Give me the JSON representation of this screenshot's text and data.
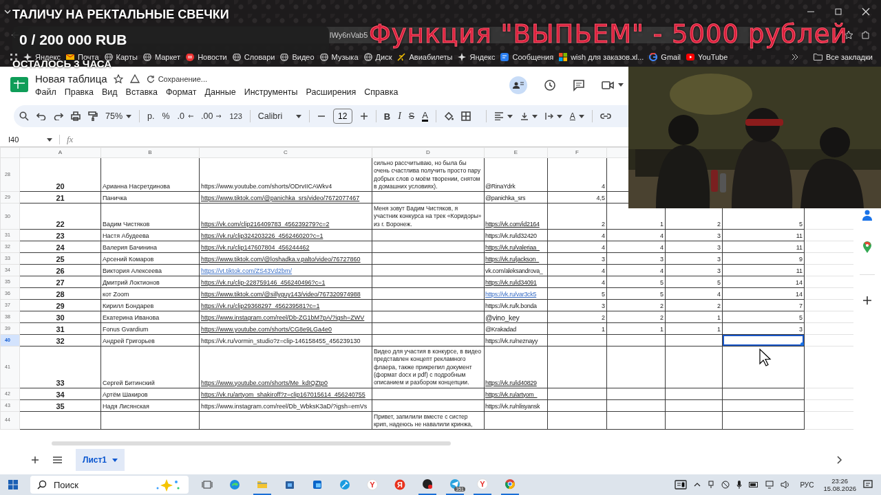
{
  "stream_overlay": {
    "title": "ТАЛИЧУ НА РЕКТАЛЬНЫЕ СВЕЧКИ",
    "goal": "0 / 200 000 RUB",
    "time_left": "ОСТАЛОСЬ 3 ЧАСА",
    "promo": "Функция \"ВЫПЬЕМ\" - 5000 рублей"
  },
  "browser": {
    "address": "lWy6nVab5",
    "bookmarks": [
      {
        "label": "Яндекс",
        "kind": "sparkle"
      },
      {
        "label": "Почта",
        "kind": "mail"
      },
      {
        "label": "Карты",
        "kind": "globe"
      },
      {
        "label": "Маркет",
        "kind": "globe"
      },
      {
        "label": "Новости",
        "kind": "news"
      },
      {
        "label": "Словари",
        "kind": "globe"
      },
      {
        "label": "Видео",
        "kind": "globe"
      },
      {
        "label": "Музыка",
        "kind": "globe"
      },
      {
        "label": "Диск",
        "kind": "globe"
      },
      {
        "label": "Авиабилеты",
        "kind": "plane"
      },
      {
        "label": "Яндекс",
        "kind": "sparkle"
      },
      {
        "label": "Сообщения",
        "kind": "chat"
      },
      {
        "label": "wish для заказов.xl...",
        "kind": "tiles"
      },
      {
        "label": "Gmail",
        "kind": "google"
      },
      {
        "label": "YouTube",
        "kind": "play"
      }
    ],
    "all_bookmarks": "Все закладки"
  },
  "sheets": {
    "doc_title": "Новая таблица",
    "save_status": "Сохранение...",
    "menu": [
      "Файл",
      "Правка",
      "Вид",
      "Вставка",
      "Формат",
      "Данные",
      "Инструменты",
      "Расширения",
      "Справка"
    ],
    "toolbar": {
      "zoom": "75%",
      "currency": "р.",
      "percent": "%",
      "decimal_less": ".0",
      "decimal_more": ".00",
      "number_format": "123",
      "font": "Calibri",
      "font_size": "12",
      "bold": "B",
      "italic": "I",
      "strikethrough": "S",
      "text_color": "A",
      "text_rotation": "A"
    },
    "name_box": "I40",
    "formula_label": "fx",
    "columns": [
      "A",
      "B",
      "C",
      "D",
      "E",
      "F"
    ],
    "rows": [
      {
        "header": "28",
        "selected": false,
        "number": "20",
        "name": "Арианна Насретдинова",
        "video": {
          "text": "https://www.youtube.com/shorts/ODrvIICAWkv4",
          "kind": "plain"
        },
        "note": "сильно рассчитываю, но была бы очень счастлива получить просто пару добрых слов о моём творении, снятом в домашних условиях).",
        "profile": {
          "text": "@RinaYdrk",
          "kind": "plain"
        },
        "scores": [
          "4"
        ]
      },
      {
        "header": "29",
        "selected": false,
        "number": "21",
        "name": "Паничка",
        "video": {
          "text": "https://www.tiktok.com/@panichka_srs/video/7672077467",
          "kind": "underlined"
        },
        "profile": {
          "text": "@panichka_srs",
          "kind": "plain"
        },
        "scores": [
          "4,5"
        ]
      },
      {
        "header": "30",
        "selected": false,
        "number": "22",
        "name": "Вадим Чистяков",
        "video": {
          "text": "https://vk.com/clip216409783_456239279?c=2",
          "kind": "underlined"
        },
        "note": "Меня зовут Вадим Чистяков, я участник конкурса на трек «Коридоры» из г. Воронеж.",
        "profile": {
          "text": "https://vk.com/id2164",
          "kind": "underlined"
        },
        "scores": [
          "2",
          "1",
          "2",
          "5"
        ]
      },
      {
        "header": "31",
        "selected": false,
        "number": "23",
        "name": "Настя Абудеева",
        "video": {
          "text": "https://vk.ru/clip324203226_456246020?c=1",
          "kind": "underlined"
        },
        "profile": {
          "text": "https://vk.ru/id32420",
          "kind": "plain"
        },
        "scores": [
          "4",
          "4",
          "3",
          "11"
        ]
      },
      {
        "header": "32",
        "selected": false,
        "number": "24",
        "name": "Валерия Бачинина",
        "video": {
          "text": "https://vk.ru/clip147607804_456244462",
          "kind": "underlined"
        },
        "profile": {
          "text": "https://vk.ru/valeriaa_",
          "kind": "underlined"
        },
        "scores": [
          "4",
          "4",
          "3",
          "11"
        ]
      },
      {
        "header": "33",
        "selected": false,
        "number": "25",
        "name": "Арсений Комаров",
        "video": {
          "text": "https://www.tiktok.com/@loshadka.v.palto/video/76727860",
          "kind": "underlined"
        },
        "profile": {
          "text": "https://vk.ru/jackson_",
          "kind": "underlined"
        },
        "scores": [
          "3",
          "3",
          "3",
          "9"
        ]
      },
      {
        "header": "34",
        "selected": false,
        "number": "26",
        "name": "Виктория Алексеева",
        "video": {
          "text": "https://vt.tiktok.com/ZS43Vd2bm/",
          "kind": "link"
        },
        "profile": {
          "text": "vk.com/aleksandrova_",
          "kind": "plain"
        },
        "scores": [
          "4",
          "4",
          "3",
          "11"
        ]
      },
      {
        "header": "35",
        "selected": false,
        "number": "27",
        "name": "Дмитрий Локтионов",
        "video": {
          "text": "https://vk.ru/clip-228759146_456240496?c=1",
          "kind": "underlined"
        },
        "profile": {
          "text": "https://vk.ru/id34091",
          "kind": "underlined"
        },
        "scores": [
          "4",
          "5",
          "5",
          "14"
        ]
      },
      {
        "header": "36",
        "selected": false,
        "number": "28",
        "name": "кот Zoom",
        "video": {
          "text": "https://www.tiktok.com/@sillyguy143/video/767320974988",
          "kind": "underlined"
        },
        "profile": {
          "text": "https://vk.ru/var3ck5",
          "kind": "link"
        },
        "scores": [
          "5",
          "5",
          "4",
          "14"
        ]
      },
      {
        "header": "37",
        "selected": false,
        "number": "29",
        "name": "Кирилл Бондарев",
        "video": {
          "text": "https://vk.ru/clip29368297_456239581?c=1",
          "kind": "underlined"
        },
        "profile": {
          "text": "https://vk.ru/k.bonda",
          "kind": "plain"
        },
        "scores": [
          "3",
          "2",
          "2",
          "7"
        ]
      },
      {
        "header": "38",
        "selected": false,
        "number": "30",
        "name": "Екатерина Иванова",
        "video": {
          "text": "https://www.instagram.com/reel/Db-ZG1bM7pA/?igsh=ZWV",
          "kind": "underlined"
        },
        "profile": {
          "text": "@vino_key",
          "kind": "large"
        },
        "scores": [
          "2",
          "2",
          "1",
          "5"
        ]
      },
      {
        "header": "39",
        "selected": false,
        "number": "31",
        "name": "Fonus Gvardium",
        "video": {
          "text": "https://www.youtube.com/shorts/CG8e9LGa4e0",
          "kind": "underlined"
        },
        "profile": {
          "text": "@Krakadad",
          "kind": "plain"
        },
        "scores": [
          "1",
          "1",
          "1",
          "3"
        ]
      },
      {
        "header": "40",
        "selected": true,
        "number": "32",
        "name": "Андрей Григорьев",
        "video": {
          "text": "https://vk.ru/vormin_studio?z=clip-146158455_456239130",
          "kind": "plain"
        },
        "profile": {
          "text": "https://vk.ru/neznayy",
          "kind": "plain"
        }
      },
      {
        "header": "41",
        "selected": false,
        "number": "33",
        "name": "Сергей Битинский",
        "video": {
          "text": "https://www.youtube.com/shorts/Me_kdIQZtp0",
          "kind": "underlined"
        },
        "note": "Видео для участия в конкурсе, в видео представлен концепт рекламного флаера, также прикрепил документ (формат docx и pdf) с подробным описанием и разбором концепции.",
        "profile": {
          "text": "https://vk.ru/id40829",
          "kind": "underlined"
        }
      },
      {
        "header": "42",
        "selected": false,
        "number": "34",
        "name": "Артём Шакиров",
        "video": {
          "text": "https://vk.ru/artyom_shakiroff?z=clip167015614_456240755",
          "kind": "underlined"
        },
        "profile": {
          "text": "https://vk.ru/artyom_",
          "kind": "underlined"
        }
      },
      {
        "header": "43",
        "selected": false,
        "number": "35",
        "name": "Надя Лисянская",
        "video": {
          "text": "https://www.instagram.com/reel/Db_WbksK3aD/?igsh=emVs",
          "kind": "plain"
        },
        "profile": {
          "text": "https://vk.ru/nlisyansk",
          "kind": "plain"
        }
      },
      {
        "header": "44",
        "selected": false,
        "note": "Привет, запилили вместе с систер крип, надеюсь не навалили кринжа,"
      }
    ],
    "sheet_tabs": [
      {
        "label": "Лист1",
        "selected": true
      }
    ]
  },
  "taskbar": {
    "search_placeholder": "Поиск",
    "language": "РУС",
    "time": "23:26",
    "date": "15.08.2026",
    "apps": [
      {
        "kind": "taskview",
        "running": false
      },
      {
        "kind": "edge",
        "running": false
      },
      {
        "kind": "explorer",
        "running": true
      },
      {
        "kind": "store",
        "running": false
      },
      {
        "kind": "outlook",
        "running": false
      },
      {
        "kind": "tool",
        "running": false
      },
      {
        "kind": "yandex-browser",
        "glyph": "Y",
        "running": false
      },
      {
        "kind": "yandex",
        "glyph": "Я",
        "running": false
      },
      {
        "kind": "recorder",
        "running": true
      },
      {
        "kind": "telegram",
        "badge": "351",
        "running": true
      },
      {
        "kind": "yandex-browser",
        "glyph": "Y",
        "running": true
      },
      {
        "kind": "chrome",
        "running": true
      }
    ]
  }
}
